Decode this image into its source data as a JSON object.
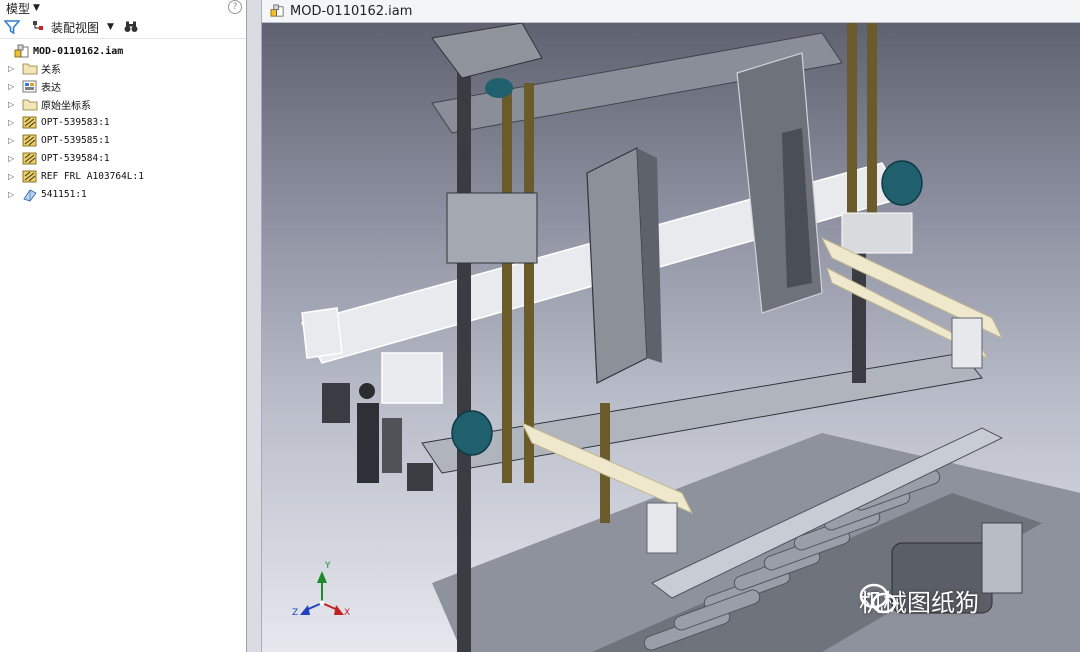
{
  "browser": {
    "header_title": "模型",
    "help_glyph": "?",
    "toolbar": {
      "view_label": "装配视图"
    },
    "root": {
      "name": "MOD-0110162.iam"
    },
    "items": [
      {
        "label": "关系",
        "icon": "folder-icon"
      },
      {
        "label": "表达",
        "icon": "representations-icon"
      },
      {
        "label": "原始坐标系",
        "icon": "folder-icon"
      },
      {
        "label": "OPT-539583:1",
        "icon": "subassembly-icon"
      },
      {
        "label": "OPT-539585:1",
        "icon": "subassembly-icon"
      },
      {
        "label": "OPT-539584:1",
        "icon": "subassembly-icon"
      },
      {
        "label": "REF FRL A103764L:1",
        "icon": "subassembly-icon"
      },
      {
        "label": "541151:1",
        "icon": "part-icon"
      }
    ]
  },
  "document": {
    "tab_title": "MOD-0110162.iam"
  },
  "viewcube": {
    "x": "X",
    "y": "Y",
    "z": "Z"
  },
  "watermark": {
    "text": "机械图纸狗",
    "icon": "wechat-icon"
  },
  "colors": {
    "accent_blue": "#2f7fd0",
    "model_gray": "#7a7e86",
    "belt": "#efe8cc",
    "gearbox": "#1f5f6e",
    "rail": "#6b5a2a"
  }
}
